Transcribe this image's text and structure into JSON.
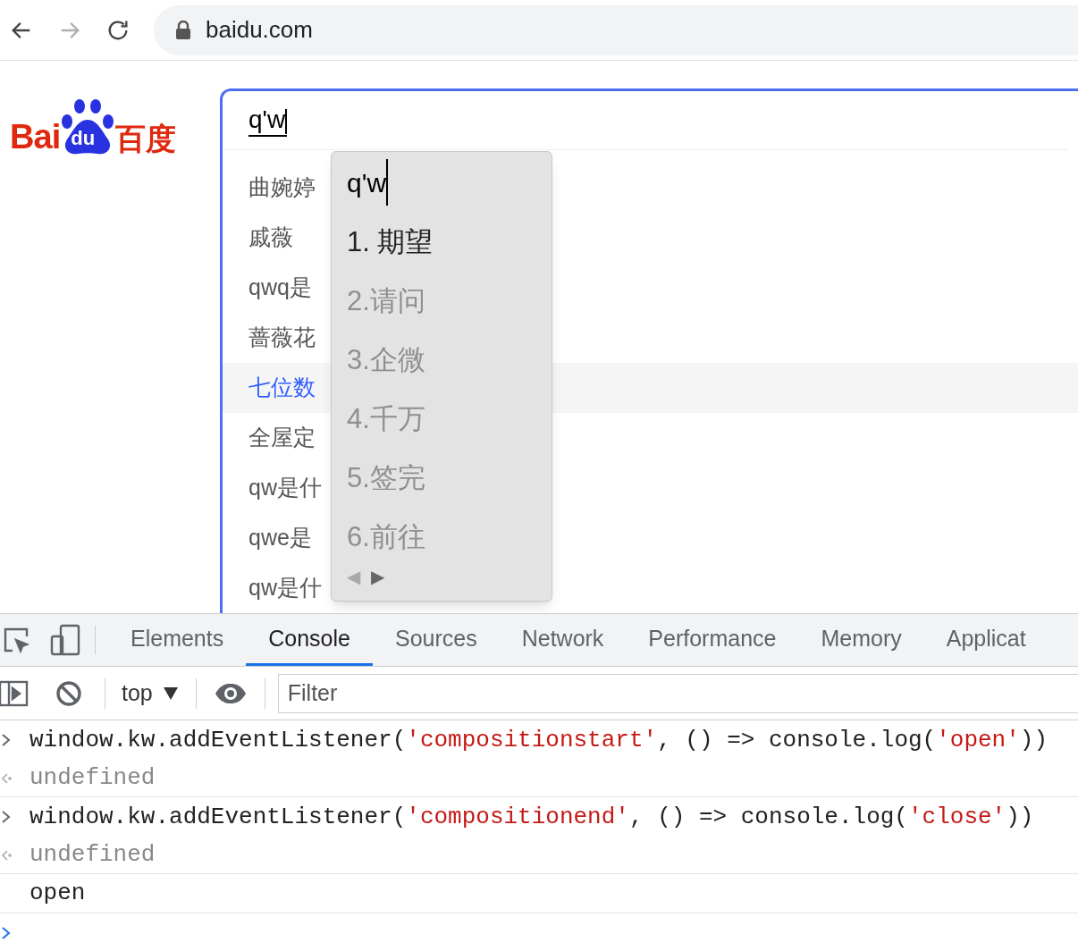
{
  "browser": {
    "back_disabled": false,
    "forward_disabled": true,
    "url": "baidu.com"
  },
  "logo": {
    "left": "Bai",
    "paw": "du",
    "right": "百度"
  },
  "search": {
    "value": "q'w"
  },
  "suggestions": [
    {
      "text": "曲婉婷",
      "selected": false
    },
    {
      "text": "戚薇",
      "selected": false
    },
    {
      "text": "qwq是",
      "selected": false
    },
    {
      "text": "蔷薇花",
      "selected": false
    },
    {
      "text": "七位数",
      "selected": true
    },
    {
      "text": "全屋定",
      "selected": false
    },
    {
      "text": "qw是什",
      "selected": false
    },
    {
      "text": "qwe是",
      "selected": false
    },
    {
      "text": "qw是什",
      "selected": false
    }
  ],
  "ime": {
    "composition": "q'w",
    "candidates": [
      {
        "text": "1. 期望",
        "selected": true
      },
      {
        "text": "2.请问",
        "selected": false
      },
      {
        "text": "3.企微",
        "selected": false
      },
      {
        "text": "4.千万",
        "selected": false
      },
      {
        "text": "5.签完",
        "selected": false
      },
      {
        "text": "6.前往",
        "selected": false
      }
    ],
    "pager": [
      {
        "text": "◀",
        "disabled": true
      },
      {
        "text": "▶",
        "disabled": false
      }
    ]
  },
  "devtools": {
    "tabs": [
      {
        "label": "Elements",
        "selected": false
      },
      {
        "label": "Console",
        "selected": true
      },
      {
        "label": "Sources",
        "selected": false
      },
      {
        "label": "Network",
        "selected": false
      },
      {
        "label": "Performance",
        "selected": false
      },
      {
        "label": "Memory",
        "selected": false
      },
      {
        "label": "Applicat",
        "selected": false
      }
    ],
    "context": "top",
    "filter_placeholder": "Filter",
    "console": [
      {
        "kind": "input",
        "parts": [
          {
            "kind": "code",
            "text": "window.kw.addEventListener("
          },
          {
            "kind": "string",
            "text": "'compositionstart'"
          },
          {
            "kind": "code",
            "text": ", () => console.log("
          },
          {
            "kind": "string",
            "text": "'open'"
          },
          {
            "kind": "code",
            "text": "))"
          }
        ]
      },
      {
        "kind": "result",
        "parts": [
          {
            "kind": "code",
            "text": "undefined"
          }
        ]
      },
      {
        "kind": "input",
        "parts": [
          {
            "kind": "code",
            "text": "window.kw.addEventListener("
          },
          {
            "kind": "string",
            "text": "'compositionend'"
          },
          {
            "kind": "code",
            "text": ", () => console.log("
          },
          {
            "kind": "string",
            "text": "'close'"
          },
          {
            "kind": "code",
            "text": "))"
          }
        ]
      },
      {
        "kind": "result",
        "parts": [
          {
            "kind": "code",
            "text": "undefined"
          }
        ]
      },
      {
        "kind": "log",
        "parts": [
          {
            "kind": "code",
            "text": "open"
          }
        ]
      },
      {
        "kind": "prompt"
      }
    ]
  }
}
